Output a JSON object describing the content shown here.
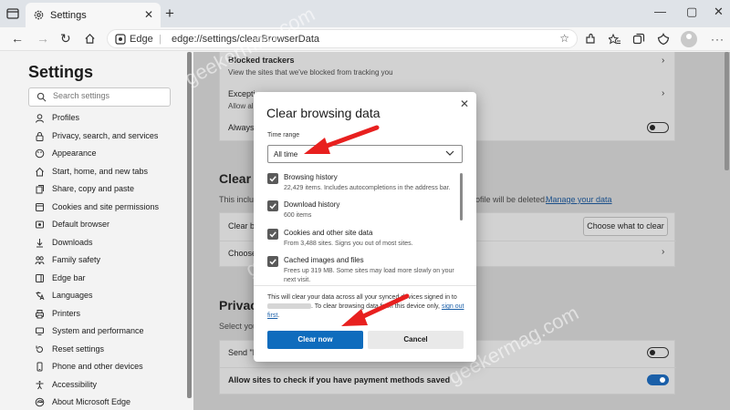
{
  "tab": {
    "title": "Settings"
  },
  "address": {
    "site": "Edge",
    "url": "edge://settings/clearBrowserData"
  },
  "sidebar": {
    "title": "Settings",
    "search_placeholder": "Search settings",
    "items": [
      {
        "label": "Profiles",
        "icon": "profile-icon"
      },
      {
        "label": "Privacy, search, and services",
        "icon": "lock-icon"
      },
      {
        "label": "Appearance",
        "icon": "appearance-icon"
      },
      {
        "label": "Start, home, and new tabs",
        "icon": "home-icon"
      },
      {
        "label": "Share, copy and paste",
        "icon": "share-icon"
      },
      {
        "label": "Cookies and site permissions",
        "icon": "cookies-icon"
      },
      {
        "label": "Default browser",
        "icon": "browser-icon"
      },
      {
        "label": "Downloads",
        "icon": "download-icon"
      },
      {
        "label": "Family safety",
        "icon": "family-icon"
      },
      {
        "label": "Edge bar",
        "icon": "edgebar-icon"
      },
      {
        "label": "Languages",
        "icon": "languages-icon"
      },
      {
        "label": "Printers",
        "icon": "printer-icon"
      },
      {
        "label": "System and performance",
        "icon": "system-icon"
      },
      {
        "label": "Reset settings",
        "icon": "reset-icon"
      },
      {
        "label": "Phone and other devices",
        "icon": "phone-icon"
      },
      {
        "label": "Accessibility",
        "icon": "accessibility-icon"
      },
      {
        "label": "About Microsoft Edge",
        "icon": "edge-icon"
      }
    ]
  },
  "content": {
    "blocked_trackers_title": "Blocked trackers",
    "blocked_trackers_sub": "View the sites that we've blocked from tracking you",
    "exceptions_title": "Exceptions",
    "exceptions_sub": "Allow all",
    "always_label": "Always",
    "clear_section": "Clear b",
    "clear_intro": "This inclu",
    "clear_intro_tail": "ofile will be deleted.",
    "manage_link": "Manage your data",
    "clear_row_label": "Clear b",
    "choose_row_label": "Choose",
    "choose_button": "Choose what to clear",
    "privacy_section": "Privacy",
    "privacy_sub": "Select you",
    "send_row_label": "Send \"D",
    "payment_row_label": "Allow sites to check if you have payment methods saved"
  },
  "dialog": {
    "title": "Clear browsing data",
    "time_range_label": "Time range",
    "time_range_value": "All time",
    "options": [
      {
        "title": "Browsing history",
        "sub": "22,429 items. Includes autocompletions in the address bar.",
        "checked": true
      },
      {
        "title": "Download history",
        "sub": "600 items",
        "checked": true
      },
      {
        "title": "Cookies and other site data",
        "sub": "From 3,488 sites. Signs you out of most sites.",
        "checked": true
      },
      {
        "title": "Cached images and files",
        "sub": "Frees up 319 MB. Some sites may load more slowly on your next visit.",
        "checked": true
      }
    ],
    "info_part1": "This will clear your data across all your synced devices signed in to",
    "info_part2": ". To clear browsing data from this device only,",
    "info_link": "sign out first",
    "info_end": ".",
    "clear_button": "Clear now",
    "cancel_button": "Cancel"
  },
  "watermark": "geekermag.com",
  "colors": {
    "accent": "#0f6cbd",
    "arrow": "#e8201f",
    "toggle_on": "#1a5fa8"
  }
}
